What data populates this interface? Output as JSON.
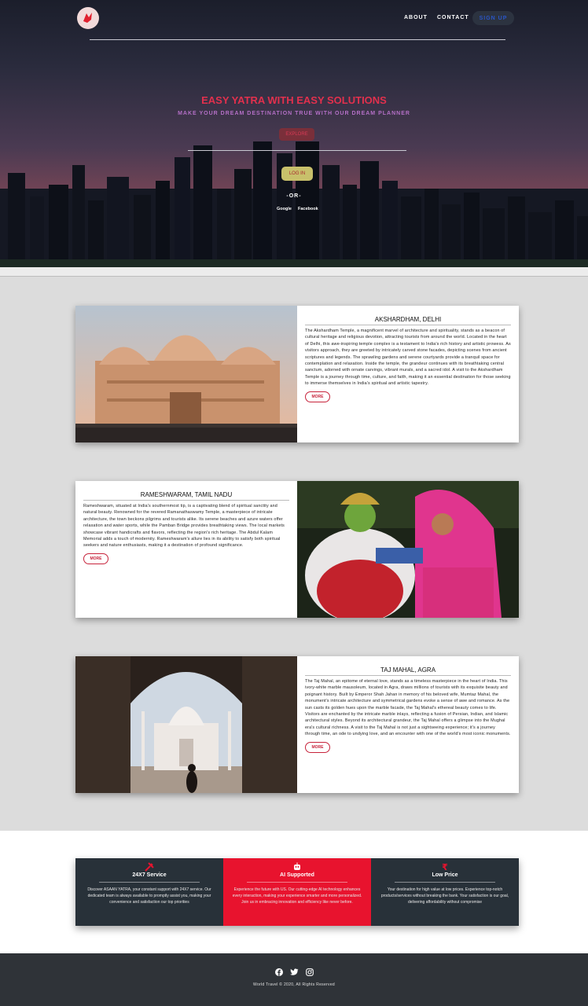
{
  "nav": {
    "links": [
      "ABOUT",
      "CONTACT"
    ],
    "signup_label": "SIGN UP"
  },
  "hero": {
    "title": "EASY YATRA WITH EASY SOLUTIONS",
    "subtitle": "MAKE YOUR DREAM DESTINATION TRUE WITH OUR DREAM PLANNER",
    "explore_label": "EXPLORE",
    "login_label": "LOG IN",
    "or_text": "-OR-",
    "social": [
      "Google",
      "Facebook"
    ]
  },
  "destinations": [
    {
      "title": "AKSHARDHAM, DELHI",
      "body": "The Akshardham Temple, a magnificent marvel of architecture and spirituality, stands as a beacon of cultural heritage and religious devotion, attracting tourists from around the world. Located in the heart of Delhi, this awe-inspiring temple complex is a testament to India's rich history and artistic prowess. As visitors approach, they are greeted by intricately carved stone facades, depicting scenes from ancient scriptures and legends. The sprawling gardens and serene courtyards provide a tranquil space for contemplation and relaxation. Inside the temple, the grandeur continues with its breathtaking central sanctum, adorned with ornate carvings, vibrant murals, and a sacred idol. A visit to the Akshardham Temple is a journey through time, culture, and faith, making it an essential destination for those seeking to immerse themselves in India's spiritual and artistic tapestry.",
      "more_label": "MORE"
    },
    {
      "title": "RAMESHWARAM, TAMIL NADU",
      "body": "Rameshwaram, situated at India's southernmost tip, is a captivating blend of spiritual sanctity and natural beauty. Renowned for the revered Ramanathaswamy Temple, a masterpiece of intricate architecture, the town beckons pilgrims and tourists alike. Its serene beaches and azure waters offer relaxation and water sports, while the Pamban Bridge provides breathtaking views. The local markets showcase vibrant handicrafts and flavors, reflecting the region's rich heritage. The Abdul Kalam Memorial adds a touch of modernity. Rameshwaram's allure lies in its ability to satisfy both spiritual seekers and nature enthusiasts, making it a destination of profound significance.",
      "more_label": "MORE"
    },
    {
      "title": "TAJ MAHAL, AGRA",
      "body": "The Taj Mahal, an epitome of eternal love, stands as a timeless masterpiece in the heart of India. This ivory-white marble mausoleum, located in Agra, draws millions of tourists with its exquisite beauty and poignant history. Built by Emperor Shah Jahan in memory of his beloved wife, Mumtaz Mahal, the monument's intricate architecture and symmetrical gardens evoke a sense of awe and romance. As the sun casts its golden hues upon the marble facade, the Taj Mahal's ethereal beauty comes to life. Visitors are enchanted by the intricate marble inlays, reflecting a fusion of Persian, Indian, and Islamic architectural styles. Beyond its architectural grandeur, the Taj Mahal offers a glimpse into the Mughal era's cultural richness. A visit to the Taj Mahal is not just a sightseeing experience; it's a journey through time, an ode to undying love, and an encounter with one of the world's most iconic monuments.",
      "more_label": "MORE"
    }
  ],
  "features": [
    {
      "icon": "tools-icon",
      "title": "24X7 Service",
      "body": "Discover ASAAN YATRA, your constant support with 24X7 service. Our dedicated team is always available to promptly assist you, making your convenience and satisfaction our top priorities",
      "bg": "#283139"
    },
    {
      "icon": "robot-icon",
      "title": "AI Supported",
      "body": "Experience the future with US. Our cutting-edge AI technology enhances every interaction, making your experience smarter and more personalized. Join us in embracing innovation and efficiency like never before.",
      "bg": "#e8132e"
    },
    {
      "icon": "rupee-icon",
      "title": "Low Price",
      "body": "Your destination for high value at low prices. Experience top-notch products/services without breaking the bank. Your satisfaction is our goal, delivering affordability without compromise",
      "bg": "#283139"
    }
  ],
  "footer": {
    "icons": [
      "facebook-icon",
      "twitter-icon",
      "instagram-icon"
    ],
    "copyright": "World Travel © 2020, All Rights Reserved"
  },
  "colors": {
    "accent_red": "#e2304d",
    "subtitle_purple": "#b46fc6",
    "signup_blue": "#2a56c8",
    "dark_panel": "#283139",
    "footer_bg": "#2f3338"
  }
}
